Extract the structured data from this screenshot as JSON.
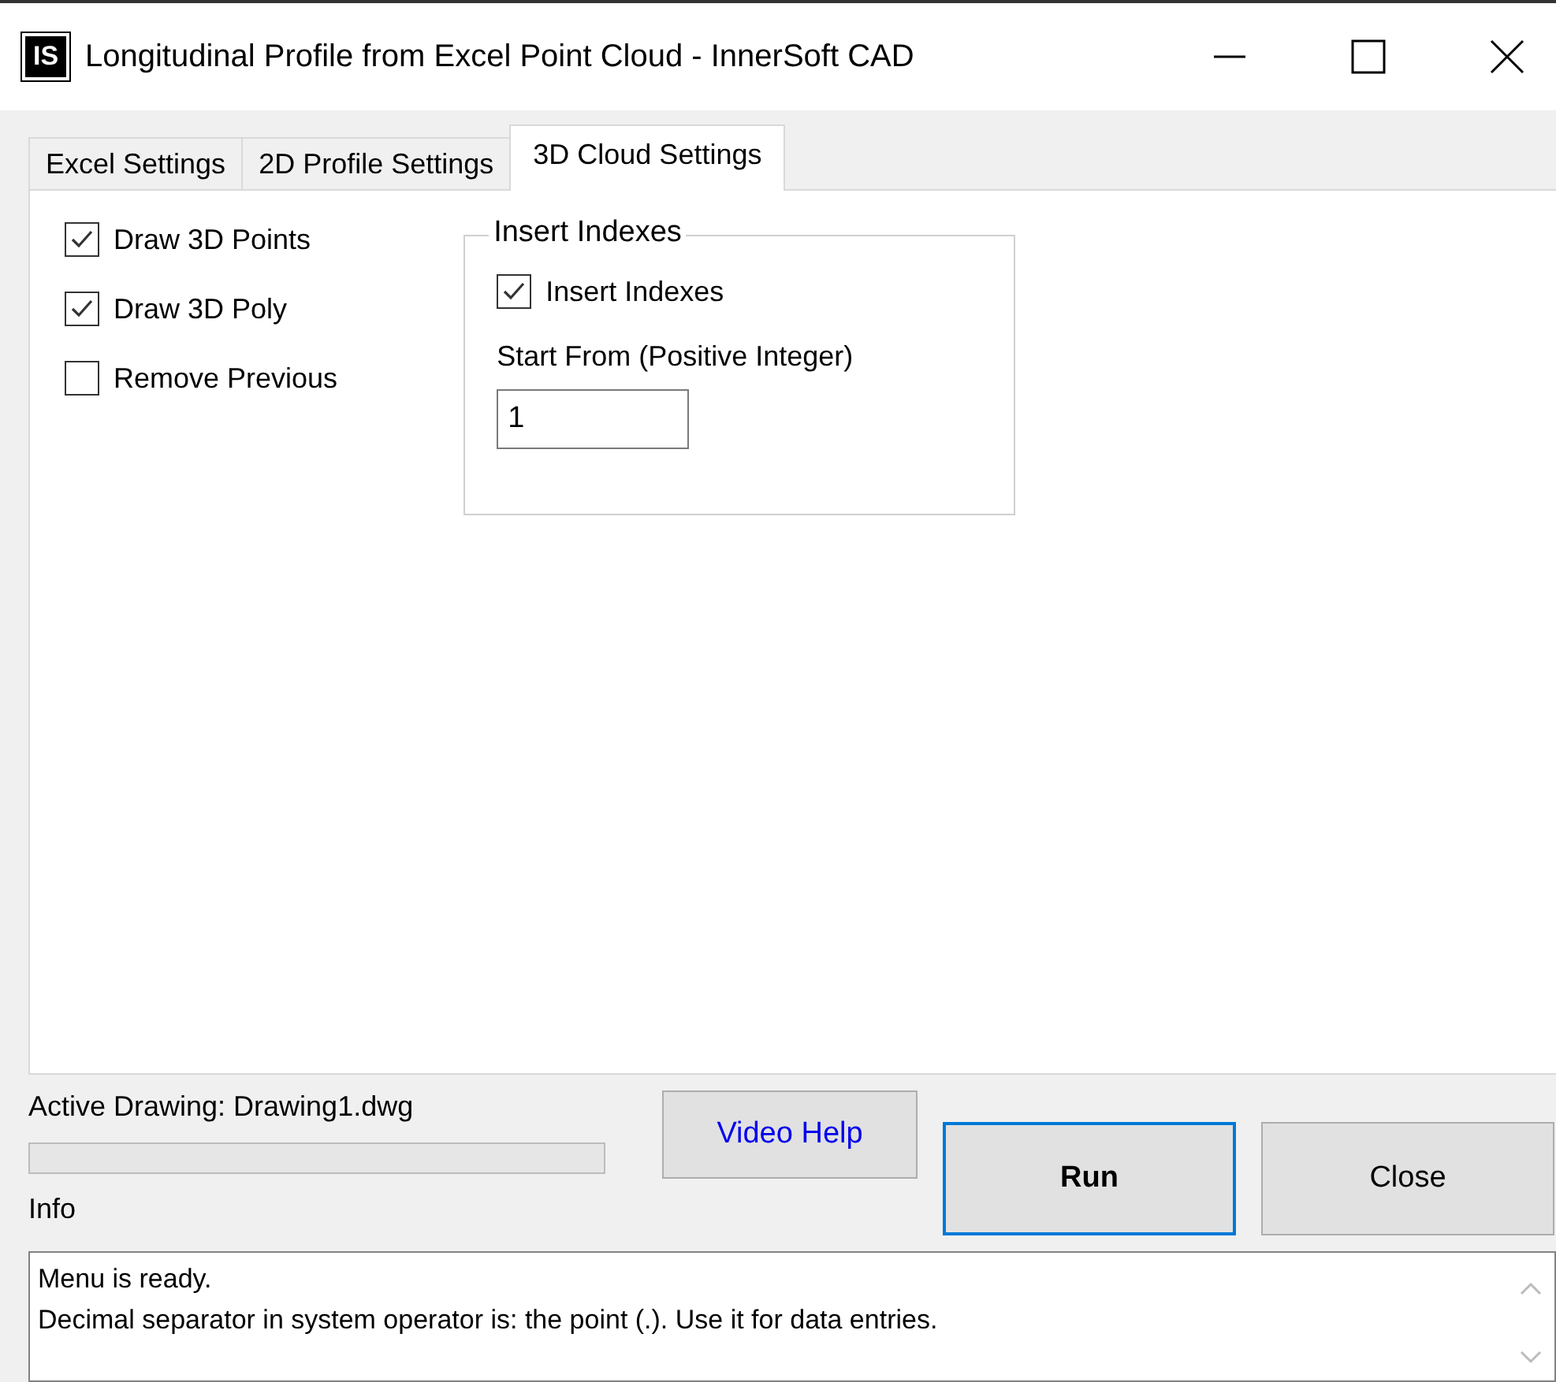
{
  "window": {
    "title": "Longitudinal Profile from Excel Point Cloud - InnerSoft CAD",
    "icon_text": "IS"
  },
  "tabs": [
    {
      "label": "Excel Settings",
      "selected": false
    },
    {
      "label": "2D Profile Settings",
      "selected": false
    },
    {
      "label": "3D Cloud Settings",
      "selected": true
    }
  ],
  "options": [
    {
      "label": "Draw 3D Points",
      "checked": true
    },
    {
      "label": "Draw 3D Poly",
      "checked": true
    },
    {
      "label": "Remove Previous",
      "checked": false
    }
  ],
  "insert_group": {
    "title": "Insert Indexes",
    "checkbox": {
      "label": "Insert Indexes",
      "checked": true
    },
    "start_label": "Start From (Positive Integer)",
    "start_value": "1"
  },
  "active_drawing": "Active Drawing: Drawing1.dwg",
  "info_label": "Info",
  "buttons": {
    "video_help": "Video Help",
    "run": "Run",
    "close": "Close"
  },
  "log": [
    "Menu is ready.",
    "Decimal separator in system operator is: the point (.). Use it for data entries."
  ]
}
